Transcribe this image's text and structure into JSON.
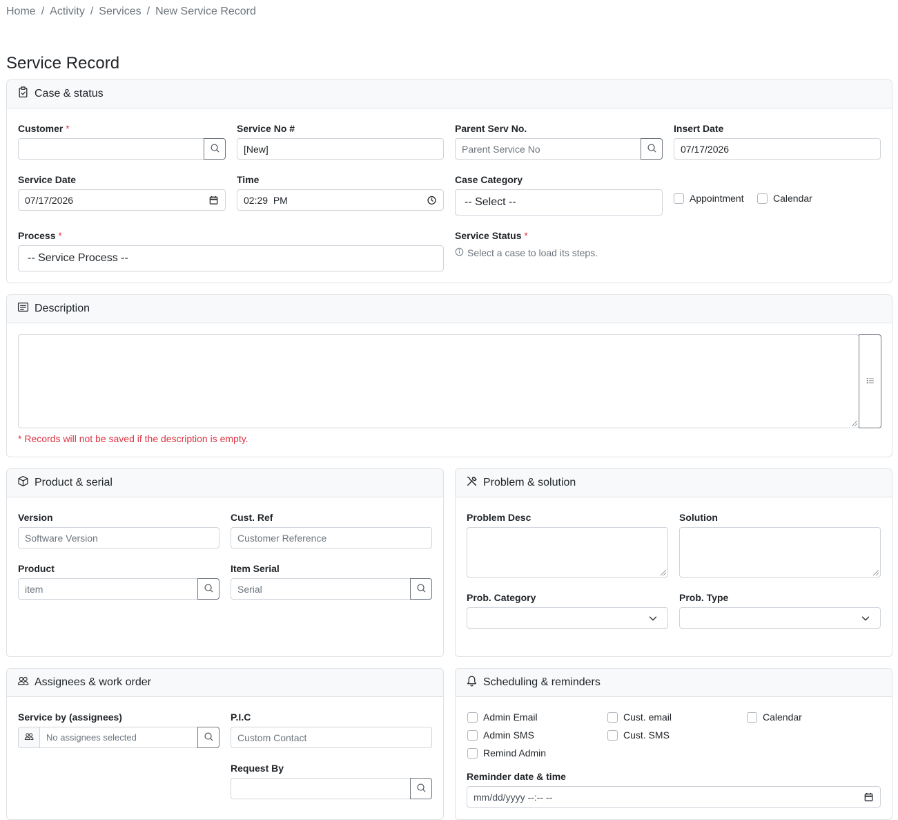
{
  "breadcrumb": {
    "items": [
      "Home",
      "Activity",
      "Services"
    ],
    "current": "New Service Record",
    "separator": "/"
  },
  "page": {
    "title": "Service Record"
  },
  "case_status": {
    "title": "Case & status",
    "customer": {
      "label": "Customer",
      "value": ""
    },
    "service_no": {
      "label": "Service No #",
      "value": "[New]"
    },
    "parent_serv": {
      "label": "Parent Serv No.",
      "placeholder": "Parent Service No"
    },
    "insert_date": {
      "label": "Insert Date",
      "value": "07/17/2026"
    },
    "service_date": {
      "label": "Service Date",
      "value": "07/17/2026"
    },
    "time": {
      "label": "Time",
      "value": "02:29  PM"
    },
    "case_category": {
      "label": "Case Category",
      "value": "-- Select --"
    },
    "appointment": {
      "label": "Appointment",
      "checked": false
    },
    "calendar": {
      "label": "Calendar",
      "checked": false
    },
    "process": {
      "label": "Process",
      "value": "-- Service Process --"
    },
    "service_status": {
      "label": "Service Status",
      "hint": "Select a case to load its steps."
    }
  },
  "description": {
    "title": "Description",
    "value": "",
    "warning": "* Records will not be saved if the description is empty."
  },
  "product_serial": {
    "title": "Product & serial",
    "version": {
      "label": "Version",
      "placeholder": "Software Version"
    },
    "cust_ref": {
      "label": "Cust. Ref",
      "placeholder": "Customer Reference"
    },
    "product": {
      "label": "Product",
      "placeholder": "item"
    },
    "item_serial": {
      "label": "Item Serial",
      "placeholder": "Serial"
    }
  },
  "problem_solution": {
    "title": "Problem & solution",
    "problem_desc": {
      "label": "Problem Desc",
      "value": ""
    },
    "solution": {
      "label": "Solution",
      "value": ""
    },
    "prob_category": {
      "label": "Prob. Category",
      "value": ""
    },
    "prob_type": {
      "label": "Prob. Type",
      "value": ""
    }
  },
  "assignees": {
    "title": "Assignees & work order",
    "service_by": {
      "label": "Service by (assignees)",
      "value": "No assignees selected"
    },
    "pic": {
      "label": "P.I.C",
      "placeholder": "Custom Contact"
    },
    "request_by": {
      "label": "Request By",
      "value": ""
    }
  },
  "scheduling": {
    "title": "Scheduling & reminders",
    "options": {
      "admin_email": "Admin Email",
      "cust_email": "Cust. email",
      "calendar": "Calendar",
      "admin_sms": "Admin SMS",
      "cust_sms": "Cust. SMS",
      "remind_admin": "Remind Admin"
    },
    "reminder": {
      "label": "Reminder date & time",
      "placeholder": "mm/dd/yyyy --:-- --"
    }
  },
  "icons": {
    "case": "clipboard-icon",
    "description": "card-text-icon",
    "product": "box-icon",
    "problem": "tools-icon",
    "assignees": "people-icon",
    "scheduling": "bell-icon"
  }
}
